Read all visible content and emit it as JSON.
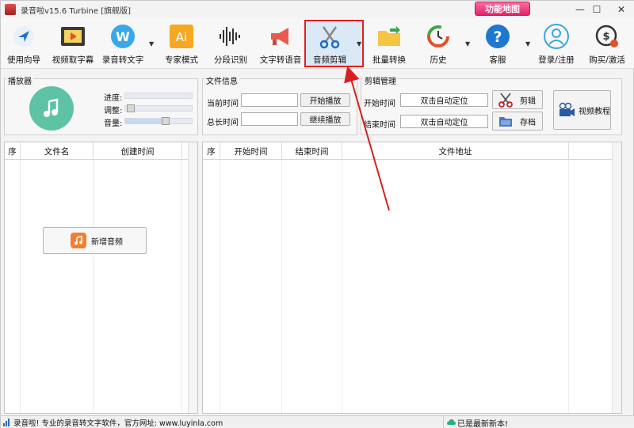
{
  "window": {
    "title": "录音啦v15.6 Turbine [旗舰版]",
    "badge": "功能地图",
    "minimize": "—",
    "maximize": "☐",
    "close": "✕"
  },
  "toolbar": {
    "items": [
      {
        "label": "使用向导",
        "icon": "navigation-arrow-icon"
      },
      {
        "label": "视频取字幕",
        "icon": "video-play-icon"
      },
      {
        "label": "录音转文字",
        "icon": "w-logo-icon"
      },
      {
        "label": "专家模式",
        "icon": "ai-icon"
      },
      {
        "label": "分段识别",
        "icon": "waveform-icon"
      },
      {
        "label": "文字转语音",
        "icon": "megaphone-icon"
      },
      {
        "label": "音频剪辑",
        "icon": "scissors-icon"
      },
      {
        "label": "批量转换",
        "icon": "folder-icon"
      },
      {
        "label": "历史",
        "icon": "history-icon"
      },
      {
        "label": "客服",
        "icon": "help-icon"
      },
      {
        "label": "登录/注册",
        "icon": "user-icon"
      },
      {
        "label": "购买/激活",
        "icon": "purchase-icon"
      }
    ]
  },
  "player": {
    "title": "播放器",
    "progress_label": "进度:",
    "adjust_label": "调整:",
    "volume_label": "音量:",
    "progress_value": 0.0,
    "adjust_value": 0.0,
    "volume_value": 0.55
  },
  "file_info": {
    "title": "文件信息",
    "current_time_label": "当前时间",
    "total_time_label": "总长时间",
    "current_time_value": "",
    "total_time_value": "",
    "start_play": "开始播放",
    "continue_play": "继续播放"
  },
  "clip": {
    "title": "剪辑管理",
    "start_label": "开始时间",
    "end_label": "结束时间",
    "start_value": "双击自动定位",
    "end_value": "双击自动定位",
    "cut_button": "剪辑",
    "save_button": "存档",
    "tutorial_button": "视频教程"
  },
  "left_table": {
    "columns": [
      "序",
      "文件名",
      "创建时间"
    ],
    "add_audio": "新增音频"
  },
  "right_table": {
    "columns": [
      "序",
      "开始时间",
      "结束时间",
      "文件地址"
    ]
  },
  "status": {
    "left": "录音啦! 专业的录音转文字软件，官方网址: www.luyinla.com",
    "right": "已是最新新本!"
  },
  "colors": {
    "accent_red": "#e02020",
    "music_green": "#5ec3a4",
    "badge_pink": "#e0246a"
  }
}
